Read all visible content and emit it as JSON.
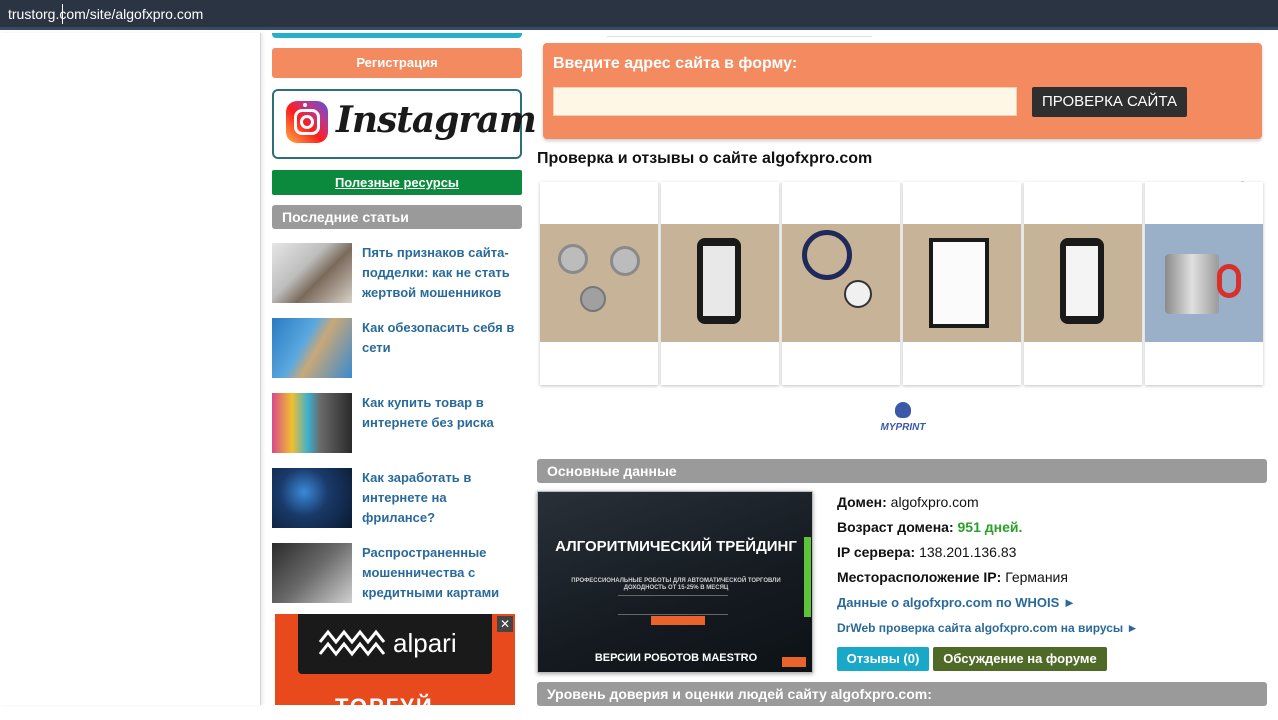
{
  "browser": {
    "address": "trustorg.com/site/algofxpro.com"
  },
  "sidebar": {
    "register_label": "Регистрация",
    "instagram_label": "Instagram",
    "resources_label": "Полезные ресурсы",
    "articles_heading": "Последние статьи",
    "articles": [
      {
        "title": "Пять признаков сайта-подделки: как не стать жертвой мошенников"
      },
      {
        "title": "Как обезопасить себя в сети"
      },
      {
        "title": "Как купить товар в интернете без риска"
      },
      {
        "title": "Как заработать в интернете на фрилансе?"
      },
      {
        "title": "Распространенные мошенничества с кредитными картами"
      }
    ],
    "ad": {
      "brand": "alpari",
      "close": "✕",
      "bottom_text": "ТОРГУЙ"
    }
  },
  "form": {
    "label": "Введите адрес сайта в форму:",
    "input_value": "",
    "input_placeholder": "",
    "button_label": "ПРОВЕРКА САЙТА"
  },
  "page": {
    "heading": "Проверка и отзывы о сайте algofxpro.com"
  },
  "ad_block": {
    "icons": "ⓘ ✕",
    "brand": "MYPRINT",
    "products": [
      "press-dies",
      "phone-case",
      "lanyard",
      "blank-sheet",
      "phone-case-2",
      "mug"
    ]
  },
  "main_data": {
    "heading": "Основные данные",
    "screenshot": {
      "title": "АЛГОРИТМИЧЕСКИЙ ТРЕЙДИНГ",
      "subtitle": "ПРОФЕССИОНАЛЬНЫЕ РОБОТЫ ДЛЯ АВТОМАТИЧЕСКОЙ ТОРГОВЛИ ДОХОДНОСТЬ ОТ 15-25% В МЕСЯЦ",
      "footer": "ВЕРСИИ РОБОТОВ MAESTRO"
    },
    "domain_label": "Домен:",
    "domain_value": "algofxpro.com",
    "age_label": "Возраст домена:",
    "age_value": "951 дней.",
    "ip_label": "IP сервера:",
    "ip_value": "138.201.136.83",
    "location_label": "Месторасположение IP:",
    "location_value": "Германия",
    "whois_link": "Данные о algofxpro.com по WHOIS ►",
    "drweb_link": "DrWeb проверка сайта algofxpro.com на вирусы ►",
    "reviews_btn": "Отзывы (0)",
    "forum_btn": "Обсуждение на форуме"
  },
  "trust": {
    "heading": "Уровень доверия и оценки людей сайту algofxpro.com:"
  }
}
